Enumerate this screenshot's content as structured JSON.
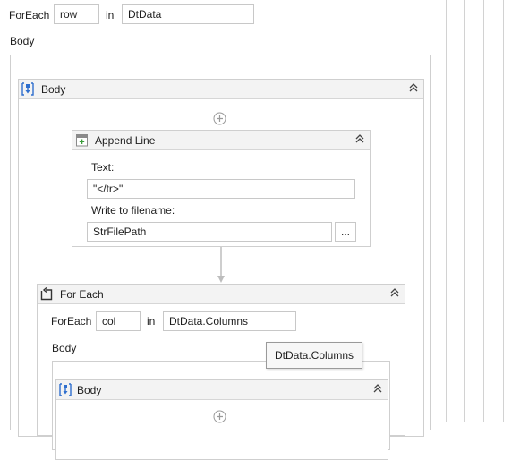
{
  "outer_foreach": {
    "foreach_label": "ForEach",
    "item_variable": "row",
    "in_label": "in",
    "collection": "DtData",
    "body_label": "Body"
  },
  "body_sequence": {
    "title": "Body"
  },
  "append_line": {
    "title": "Append Line",
    "text_label": "Text:",
    "text_value": "\"</tr>\"",
    "filename_label": "Write to filename:",
    "filename_value": "StrFilePath",
    "browse_label": "..."
  },
  "inner_foreach": {
    "title": "For Each",
    "foreach_label": "ForEach",
    "item_variable": "col",
    "in_label": "in",
    "collection": "DtData.Columns",
    "body_label": "Body",
    "tooltip": "DtData.Columns",
    "body_sequence_title": "Body"
  },
  "icons": {
    "sequence": "sequence-icon",
    "append_line": "append-line-icon",
    "foreach": "foreach-icon",
    "add": "add-activity-icon",
    "collapse": "collapse-chevron-icon"
  },
  "colors": {
    "header_bg": "#f3f3f3",
    "border": "#cfcfcf",
    "accent_blue": "#2f6fce",
    "append_green": "#3a9c3a"
  }
}
